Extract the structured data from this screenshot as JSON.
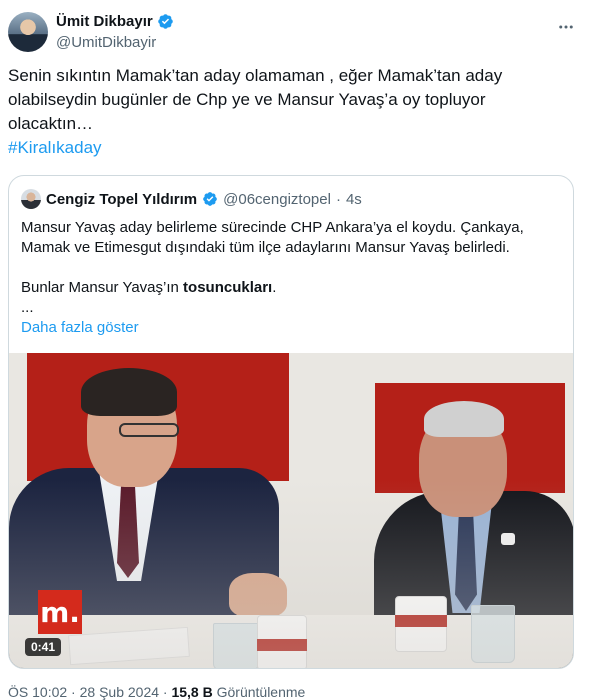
{
  "author": {
    "name": "Ümit Dikbayır",
    "handle": "@UmitDikbayir",
    "verified": true
  },
  "tweet": {
    "text": "Senin sıkıntın Mamak’tan aday olamaman , eğer Mamak’tan aday olabilseydin bugünler de Chp ye ve Mansur Yavaş’a oy topluyor olacaktın…",
    "hashtag": "#Kiralıkaday"
  },
  "quote": {
    "author_name": "Cengiz Topel Yıldırım",
    "author_handle": "@06cengiztopel",
    "separator": "·",
    "time": "4s",
    "paragraph1": "Mansur Yavaş aday belirleme sürecinde CHP Ankara’ya el koydu. Çankaya, Mamak ve Etimesgut dışındaki tüm ilçe adaylarını Mansur Yavaş belirledi.",
    "paragraph2_prefix": "Bunlar Mansur Yavaş’ın ",
    "paragraph2_bold": "tosuncukları",
    "paragraph2_suffix": ".",
    "ellipsis": "...",
    "show_more": "Daha fazla göster",
    "video": {
      "badge": "m.",
      "duration": "0:41"
    }
  },
  "meta": {
    "time": "ÖS 10:02",
    "date": "28 Şub 2024",
    "separator1": "·",
    "separator2": "·",
    "views": "15,8 B",
    "views_label": "Görüntülenme"
  },
  "colors": {
    "link": "#1d9bf0",
    "verified": "#1d9bf0",
    "text": "#0f1419",
    "muted": "#536471"
  },
  "icons": {
    "verified": "verified-badge-icon",
    "more": "more-horizontal-icon"
  }
}
